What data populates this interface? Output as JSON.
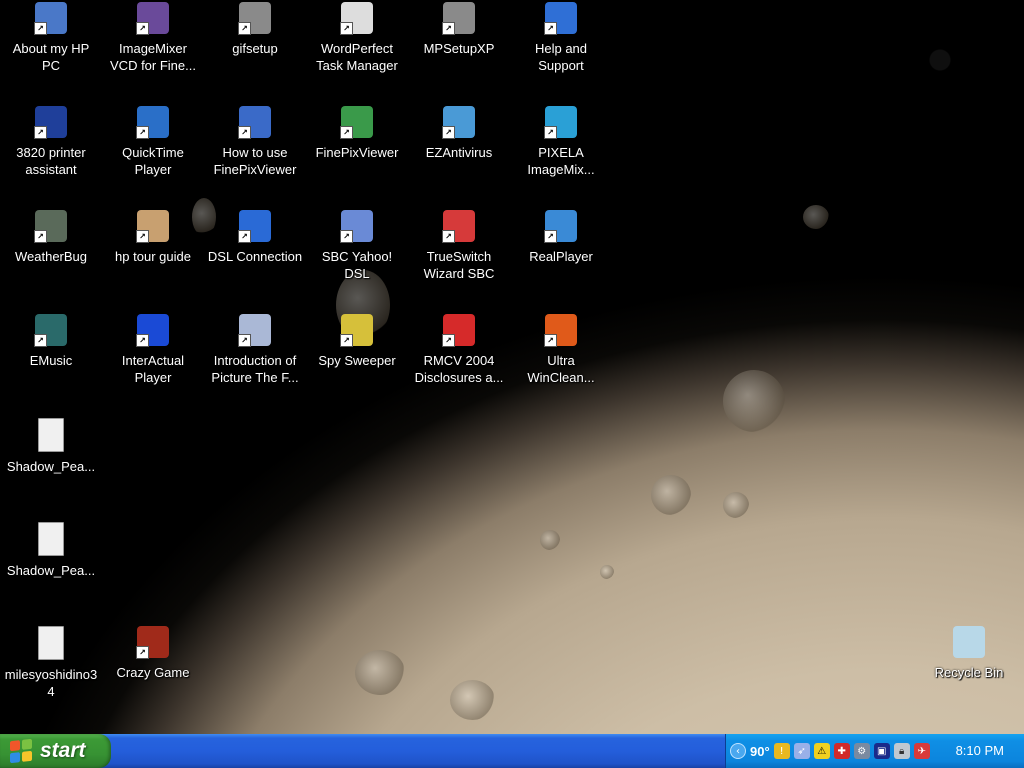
{
  "desktop": {
    "icons": [
      {
        "label": "About my HP PC",
        "icon": "info-pc-icon",
        "color": "#4a78c8"
      },
      {
        "label": "ImageMixer VCD for Fine...",
        "icon": "imagemixer-icon",
        "color": "#6a4a9a"
      },
      {
        "label": "gifsetup",
        "icon": "setup-icon",
        "color": "#8a8a8a"
      },
      {
        "label": "WordPerfect Task Manager",
        "icon": "wordperfect-icon",
        "color": "#dddddd"
      },
      {
        "label": "MPSetupXP",
        "icon": "setup-icon",
        "color": "#8a8a8a"
      },
      {
        "label": "Help and Support",
        "icon": "help-icon",
        "color": "#2f6fd6"
      },
      {
        "label": "3820 printer assistant",
        "icon": "hp-icon",
        "color": "#1f3f9a"
      },
      {
        "label": "QuickTime Player",
        "icon": "quicktime-icon",
        "color": "#2a6fc8"
      },
      {
        "label": "How to use FinePixViewer",
        "icon": "help-document-icon",
        "color": "#3a6ac8"
      },
      {
        "label": "FinePixViewer",
        "icon": "finepix-icon",
        "color": "#3a9a4a"
      },
      {
        "label": "EZAntivirus",
        "icon": "antivirus-icon",
        "color": "#4a9ad6"
      },
      {
        "label": "PIXELA ImageMix...",
        "icon": "pixela-icon",
        "color": "#2aa0d6"
      },
      {
        "label": "WeatherBug",
        "icon": "weatherbug-icon",
        "color": "#5a6a5a"
      },
      {
        "label": "hp tour guide",
        "icon": "tour-guide-icon",
        "color": "#c8a070"
      },
      {
        "label": "DSL Connection",
        "icon": "dsl-icon",
        "color": "#2a6ad6"
      },
      {
        "label": "SBC Yahoo! DSL",
        "icon": "rocket-icon",
        "color": "#6a8ad6"
      },
      {
        "label": "TrueSwitch Wizard SBC",
        "icon": "trueswitch-icon",
        "color": "#d63a3a"
      },
      {
        "label": "RealPlayer",
        "icon": "realplayer-icon",
        "color": "#3a8ad6"
      },
      {
        "label": "EMusic",
        "icon": "emusic-icon",
        "color": "#2a6a6a"
      },
      {
        "label": "InterActual Player",
        "icon": "interactual-icon",
        "color": "#1a4ad6"
      },
      {
        "label": "Introduction of Picture The F...",
        "icon": "document-icon",
        "color": "#aab8d6"
      },
      {
        "label": "Spy Sweeper",
        "icon": "spy-sweeper-icon",
        "color": "#d6c03a"
      },
      {
        "label": "RMCV 2004 Disclosures a...",
        "icon": "pdf-icon",
        "color": "#d62a2a"
      },
      {
        "label": "Ultra WinClean...",
        "icon": "winclean-icon",
        "color": "#e05a1a"
      },
      {
        "label": "Shadow_Pea...",
        "icon": "image-file-icon",
        "color": "#f0f0f0"
      },
      {
        "label": "Shadow_Pea...",
        "icon": "image-file-icon",
        "color": "#f0f0f0"
      },
      {
        "label": "milesyoshidino34",
        "icon": "image-file-icon",
        "color": "#f0f0f0"
      },
      {
        "label": "Crazy Game",
        "icon": "game-icon",
        "color": "#a02a1a"
      },
      {
        "label": "Recycle Bin",
        "icon": "recycle-bin-icon",
        "color": "#b8d8e8"
      }
    ]
  },
  "taskbar": {
    "start_label": "start",
    "tray": {
      "temperature": "90°",
      "clock": "8:10 PM",
      "icons": [
        "expand-tray-icon",
        "shield-icon",
        "rocket-icon",
        "warning-icon",
        "security-icon",
        "network-icon",
        "monitor-icon",
        "lock-icon",
        "trueswitch-icon"
      ]
    }
  }
}
